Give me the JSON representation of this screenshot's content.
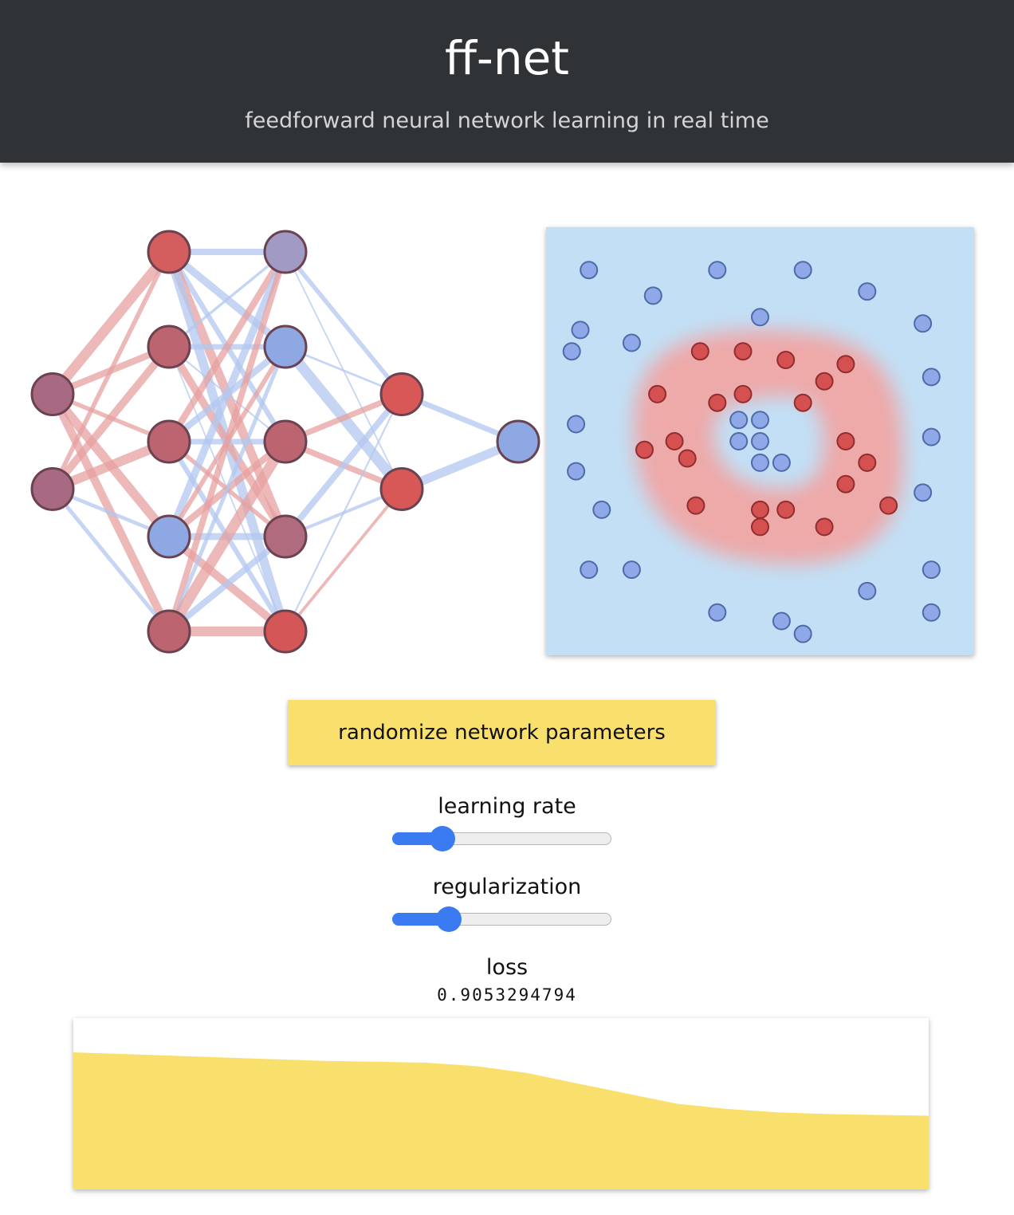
{
  "header": {
    "title": "ff-net",
    "subtitle": "feedforward neural network learning in real time"
  },
  "network": {
    "layers": [
      [
        {
          "color": "#a86a82"
        },
        {
          "color": "#a86a82"
        }
      ],
      [
        {
          "color": "#d45d5d"
        },
        {
          "color": "#bd6471"
        },
        {
          "color": "#bd6471"
        },
        {
          "color": "#8ea8e4"
        },
        {
          "color": "#bd6471"
        }
      ],
      [
        {
          "color": "#a09ac4"
        },
        {
          "color": "#8ea8e4"
        },
        {
          "color": "#bd6471"
        },
        {
          "color": "#b06b7e"
        },
        {
          "color": "#d45656"
        }
      ],
      [
        {
          "color": "#d85858"
        },
        {
          "color": "#d85858"
        }
      ],
      [
        {
          "color": "#8ea8e4"
        }
      ]
    ],
    "edge_colors": {
      "positive": "#e7a1a1",
      "negative": "#b3c8ef"
    }
  },
  "classifier": {
    "background_color": "#c2dff5",
    "region_color": "#eea9a9",
    "blue_color": "#8fa9e8",
    "red_color": "#d55050",
    "blue_points": [
      [
        -0.8,
        0.8
      ],
      [
        -0.2,
        0.8
      ],
      [
        0.2,
        0.8
      ],
      [
        -0.5,
        0.68
      ],
      [
        0,
        0.58
      ],
      [
        0.5,
        0.7
      ],
      [
        0.76,
        0.55
      ],
      [
        -0.84,
        0.52
      ],
      [
        -0.88,
        0.42
      ],
      [
        -0.6,
        0.46
      ],
      [
        0.8,
        0.3
      ],
      [
        -0.86,
        0.08
      ],
      [
        0.8,
        0.02
      ],
      [
        -0.86,
        -0.14
      ],
      [
        0.76,
        -0.24
      ],
      [
        -0.74,
        -0.32
      ],
      [
        -0.8,
        -0.6
      ],
      [
        -0.6,
        -0.6
      ],
      [
        0.8,
        -0.6
      ],
      [
        0.5,
        -0.7
      ],
      [
        0.8,
        -0.8
      ],
      [
        -0.2,
        -0.8
      ],
      [
        0.1,
        -0.84
      ],
      [
        0.2,
        -0.9
      ],
      [
        -0.1,
        0.1
      ],
      [
        0,
        0.1
      ],
      [
        -0.1,
        0
      ],
      [
        0,
        0
      ],
      [
        0,
        -0.1
      ],
      [
        0.1,
        -0.1
      ]
    ],
    "red_points": [
      [
        -0.28,
        0.42
      ],
      [
        -0.08,
        0.42
      ],
      [
        0.12,
        0.38
      ],
      [
        0.4,
        0.36
      ],
      [
        0.3,
        0.28
      ],
      [
        -0.48,
        0.22
      ],
      [
        -0.2,
        0.18
      ],
      [
        -0.08,
        0.22
      ],
      [
        0.2,
        0.18
      ],
      [
        -0.4,
        0
      ],
      [
        -0.54,
        -0.04
      ],
      [
        -0.34,
        -0.08
      ],
      [
        0.4,
        0
      ],
      [
        0.5,
        -0.1
      ],
      [
        0.4,
        -0.2
      ],
      [
        0.6,
        -0.3
      ],
      [
        -0.3,
        -0.3
      ],
      [
        0,
        -0.32
      ],
      [
        0.12,
        -0.32
      ],
      [
        0,
        -0.4
      ],
      [
        0.3,
        -0.4
      ]
    ]
  },
  "controls": {
    "button_label": "randomize network parameters",
    "learning_rate_label": "learning rate",
    "learning_rate_value": 0.2,
    "regularization_label": "regularization",
    "regularization_value": 0.23,
    "loss_label": "loss",
    "loss_value": "0.9053294794"
  },
  "loss_chart": {
    "fill_color": "#f9df6c",
    "history": [
      0.2,
      0.21,
      0.22,
      0.23,
      0.24,
      0.25,
      0.255,
      0.26,
      0.28,
      0.32,
      0.38,
      0.44,
      0.5,
      0.53,
      0.55,
      0.56,
      0.565,
      0.57
    ]
  }
}
